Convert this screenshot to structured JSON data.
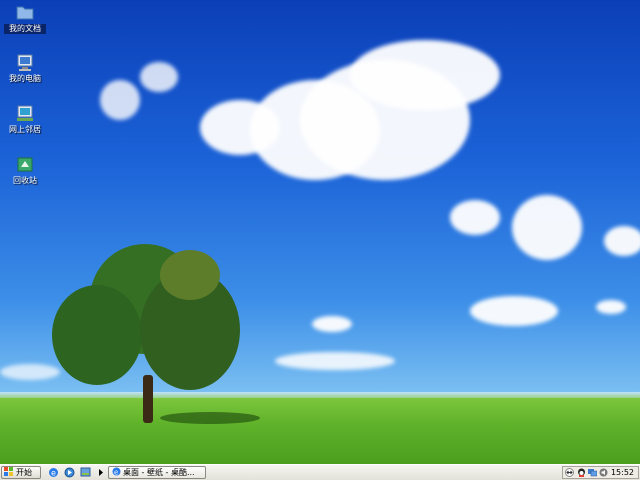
{
  "desktop": {
    "icons": [
      {
        "label": "我的文档"
      },
      {
        "label": "我的电脑"
      },
      {
        "label": "网上邻居"
      },
      {
        "label": "回收站"
      }
    ]
  },
  "taskbar": {
    "start_label": "开始",
    "task_label": "桌面 - 壁纸 - 桌酷...",
    "clock": "15:52"
  },
  "colors": {
    "sky_top": "#0b3fb8",
    "grass": "#5fb22a",
    "selection": "#0a246a"
  },
  "icon_names": [
    "folder-icon",
    "computer-icon",
    "network-icon",
    "recycle-bin-icon",
    "windows-logo-icon",
    "ie-icon",
    "media-icon",
    "show-desktop-icon",
    "expand-arrow-icon",
    "ie-small-icon",
    "tray-qq-icon",
    "tray-network-icon",
    "tray-volume-icon"
  ]
}
